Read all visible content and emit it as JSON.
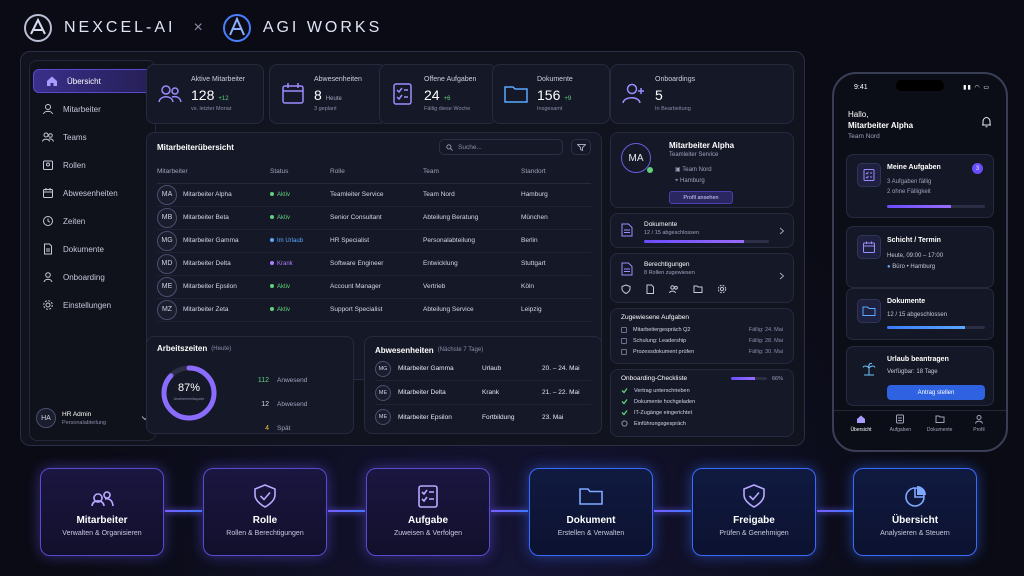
{
  "header": {
    "brand_left": "NEXCEL-AI",
    "separator": "×",
    "brand_right": "AGI WORKS"
  },
  "sidebar": {
    "items": [
      {
        "label": "Übersicht",
        "icon": "home-icon"
      },
      {
        "label": "Mitarbeiter",
        "icon": "user-icon"
      },
      {
        "label": "Teams",
        "icon": "users-icon"
      },
      {
        "label": "Rollen",
        "icon": "badge-icon"
      },
      {
        "label": "Abwesenheiten",
        "icon": "calendar-icon"
      },
      {
        "label": "Zeiten",
        "icon": "clock-icon"
      },
      {
        "label": "Dokumente",
        "icon": "document-icon"
      },
      {
        "label": "Onboarding",
        "icon": "onboarding-icon"
      },
      {
        "label": "Einstellungen",
        "icon": "gear-icon"
      }
    ],
    "user": {
      "initials": "HA",
      "name": "HR Admin",
      "dept": "Personalabteilung"
    }
  },
  "kpis": [
    {
      "label": "Aktive Mitarbeiter",
      "value": "128",
      "delta": "+12",
      "sub": "vs. letzter Monat"
    },
    {
      "label": "Abwesenheiten",
      "value": "8",
      "delta": "Heute",
      "sub": "3 geplant"
    },
    {
      "label": "Offene Aufgaben",
      "value": "24",
      "delta": "+6",
      "sub": "Fällig diese Woche"
    },
    {
      "label": "Dokumente",
      "value": "156",
      "delta": "+9",
      "sub": "Insgesamt"
    },
    {
      "label": "Onboardings",
      "value": "5",
      "delta": "",
      "sub": "In Bearbeitung"
    }
  ],
  "employees": {
    "title": "Mitarbeiterübersicht",
    "search_placeholder": "Suche...",
    "columns": [
      "Mitarbeiter",
      "Status",
      "Rolle",
      "Team",
      "Standort"
    ],
    "rows": [
      {
        "initials": "MA",
        "name": "Mitarbeiter Alpha",
        "status": "Aktiv",
        "status_color": "#5fd37a",
        "role": "Teamleiter Service",
        "team": "Team Nord",
        "location": "Hamburg"
      },
      {
        "initials": "MB",
        "name": "Mitarbeiter Beta",
        "status": "Aktiv",
        "status_color": "#5fd37a",
        "role": "Senior Consultant",
        "team": "Abteilung Beratung",
        "location": "München"
      },
      {
        "initials": "MG",
        "name": "Mitarbeiter Gamma",
        "status": "Im Urlaub",
        "status_color": "#5aa8ff",
        "role": "HR Specialist",
        "team": "Personalabteilung",
        "location": "Berlin"
      },
      {
        "initials": "MD",
        "name": "Mitarbeiter Delta",
        "status": "Krank",
        "status_color": "#b07cff",
        "role": "Software Engineer",
        "team": "Entwicklung",
        "location": "Stuttgart"
      },
      {
        "initials": "ME",
        "name": "Mitarbeiter Epsilon",
        "status": "Aktiv",
        "status_color": "#5fd37a",
        "role": "Account Manager",
        "team": "Vertrieb",
        "location": "Köln"
      },
      {
        "initials": "MZ",
        "name": "Mitarbeiter Zeta",
        "status": "Aktiv",
        "status_color": "#5fd37a",
        "role": "Support Specialist",
        "team": "Abteilung Service",
        "location": "Leipzig"
      }
    ]
  },
  "worktime": {
    "title": "Arbeitszeiten",
    "subtitle": "(Heute)",
    "percent": "87%",
    "percent_value": 0.87,
    "ring_label": "Anwesenheitsquote",
    "items": [
      {
        "value": "112",
        "label": "Anwesend",
        "color": "#5fd37a"
      },
      {
        "value": "12",
        "label": "Abwesend",
        "color": "#d3d7e7"
      },
      {
        "value": "4",
        "label": "Spät",
        "color": "#e9c440"
      }
    ]
  },
  "absences": {
    "title": "Abwesenheiten",
    "subtitle": "(Nächste 7 Tage)",
    "rows": [
      {
        "initials": "MG",
        "name": "Mitarbeiter Gamma",
        "type": "Urlaub",
        "dates": "20. – 24. Mai"
      },
      {
        "initials": "ME",
        "name": "Mitarbeiter Delta",
        "type": "Krank",
        "dates": "21. – 22. Mai"
      },
      {
        "initials": "ME",
        "name": "Mitarbeiter Epsilon",
        "type": "Fortbildung",
        "dates": "23. Mai"
      }
    ]
  },
  "profile": {
    "initials": "MA",
    "name": "Mitarbeiter Alpha",
    "role": "Teamleiter Service",
    "team": "Team Nord",
    "location": "Hamburg",
    "button": "Profil ansehen"
  },
  "docs_card": {
    "title": "Dokumente",
    "sub": "12 / 15 abgeschlossen",
    "progress": 0.8
  },
  "perms_card": {
    "title": "Berechtigungen",
    "sub": "8 Rollen zugewiesen"
  },
  "tasks": {
    "title": "Zugewiesene Aufgaben",
    "items": [
      {
        "label": "Mitarbeitergespräch Q2",
        "due": "Fällig: 24. Mai"
      },
      {
        "label": "Schulung: Leadership",
        "due": "Fällig: 28. Mai"
      },
      {
        "label": "Prozessdokument prüfen",
        "due": "Fällig: 30. Mai"
      }
    ]
  },
  "checklist": {
    "title": "Onboarding-Checkliste",
    "percent": "66%",
    "progress": 0.66,
    "items": [
      {
        "label": "Vertrag unterschrieben",
        "done": true
      },
      {
        "label": "Dokumente hochgeladen",
        "done": true
      },
      {
        "label": "IT-Zugänge eingerichtet",
        "done": true
      },
      {
        "label": "Einführungsgespräch",
        "done": false
      }
    ]
  },
  "phone": {
    "time": "9:41",
    "greeting": "Hallo,",
    "name": "Mitarbeiter Alpha",
    "team": "Team Nord",
    "cards": [
      {
        "title": "Meine Aufgaben",
        "badge": "3",
        "l1": "3 Aufgaben fällig",
        "l2": "2 ohne Fälligkeit",
        "progress": 0.65
      },
      {
        "title": "Schicht / Termin",
        "l1": "Heute, 09:00 – 17:00",
        "l2": "Büro • Hamburg"
      },
      {
        "title": "Dokumente",
        "l1": "12 / 15 abgeschlossen",
        "progress": 0.8
      },
      {
        "title": "Urlaub beantragen",
        "l1": "Verfügbar: 18 Tage",
        "button": "Antrag stellen"
      }
    ],
    "tabs": [
      "Übersicht",
      "Aufgaben",
      "Dokumente",
      "Profil"
    ]
  },
  "flow": [
    {
      "title": "Mitarbeiter",
      "sub": "Verwalten & Organisieren",
      "icon": "users-icon"
    },
    {
      "title": "Rolle",
      "sub": "Rollen & Berechtigungen",
      "icon": "shield-check-icon"
    },
    {
      "title": "Aufgabe",
      "sub": "Zuweisen & Verfolgen",
      "icon": "checklist-icon"
    },
    {
      "title": "Dokument",
      "sub": "Erstellen & Verwalten",
      "icon": "folder-icon"
    },
    {
      "title": "Freigabe",
      "sub": "Prüfen & Genehmigen",
      "icon": "shield-check-icon"
    },
    {
      "title": "Übersicht",
      "sub": "Analysieren & Steuern",
      "icon": "pie-chart-icon"
    }
  ],
  "colors": {
    "accent": "#7c5cff",
    "accent2": "#3a7bff",
    "green": "#5fd37a"
  }
}
